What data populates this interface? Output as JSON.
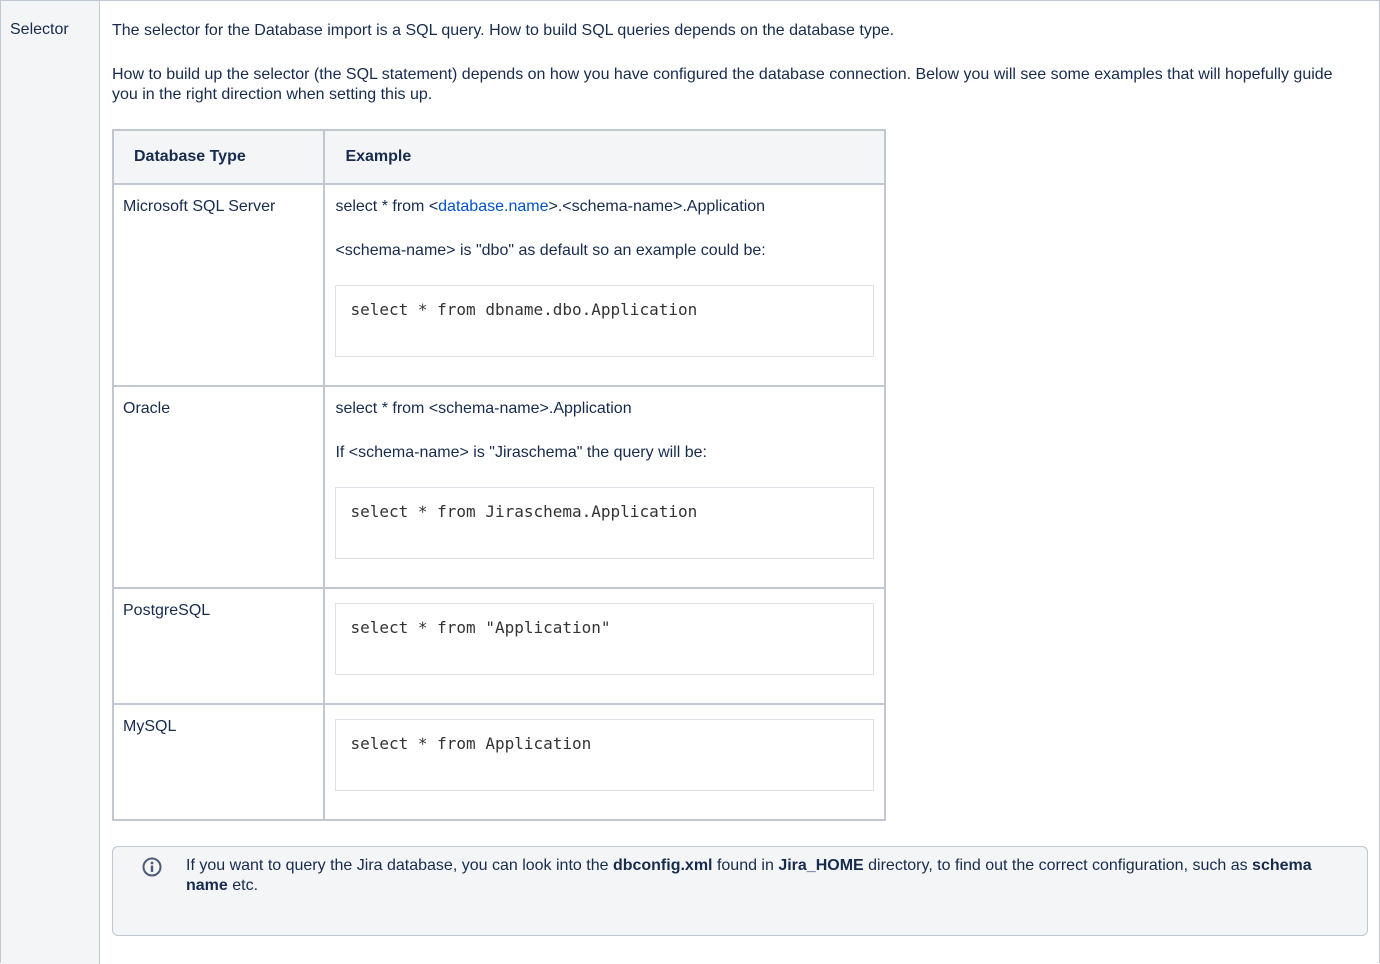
{
  "row_header": "Selector",
  "intro": "The selector for the Database import is a SQL query. How to build SQL queries depends on the database type.",
  "description": "How to build up the selector (the SQL statement) depends on how you have configured the database connection. Below you will see some examples that will hopefully guide you in the right direction when setting this up.",
  "table": {
    "headers": [
      "Database Type",
      "Example"
    ],
    "rows": [
      {
        "type": "Microsoft SQL Server",
        "line1_prefix": "select * from <",
        "line1_link": "database.name",
        "line1_suffix": ">.<schema-name>.Application",
        "line2": "<schema-name> is \"dbo\" as default so an example could be:",
        "code": "select * from dbname.dbo.Application"
      },
      {
        "type": "Oracle",
        "line1": "select * from <schema-name>.Application",
        "line2": "If <schema-name> is \"Jiraschema\" the query will be:",
        "code": "select * from Jiraschema.Application"
      },
      {
        "type": "PostgreSQL",
        "code": "select * from \"Application\""
      },
      {
        "type": "MySQL",
        "code": "select * from Application"
      }
    ]
  },
  "info": {
    "icon": "info-icon",
    "text_1": "If you want to query the Jira database, you can look into the ",
    "bold_1": "dbconfig.xml",
    "text_2": " found in ",
    "bold_2": "Jira_HOME",
    "text_3": " directory, to find out the correct configuration, such as ",
    "bold_3": "schema name",
    "text_4": " etc."
  }
}
